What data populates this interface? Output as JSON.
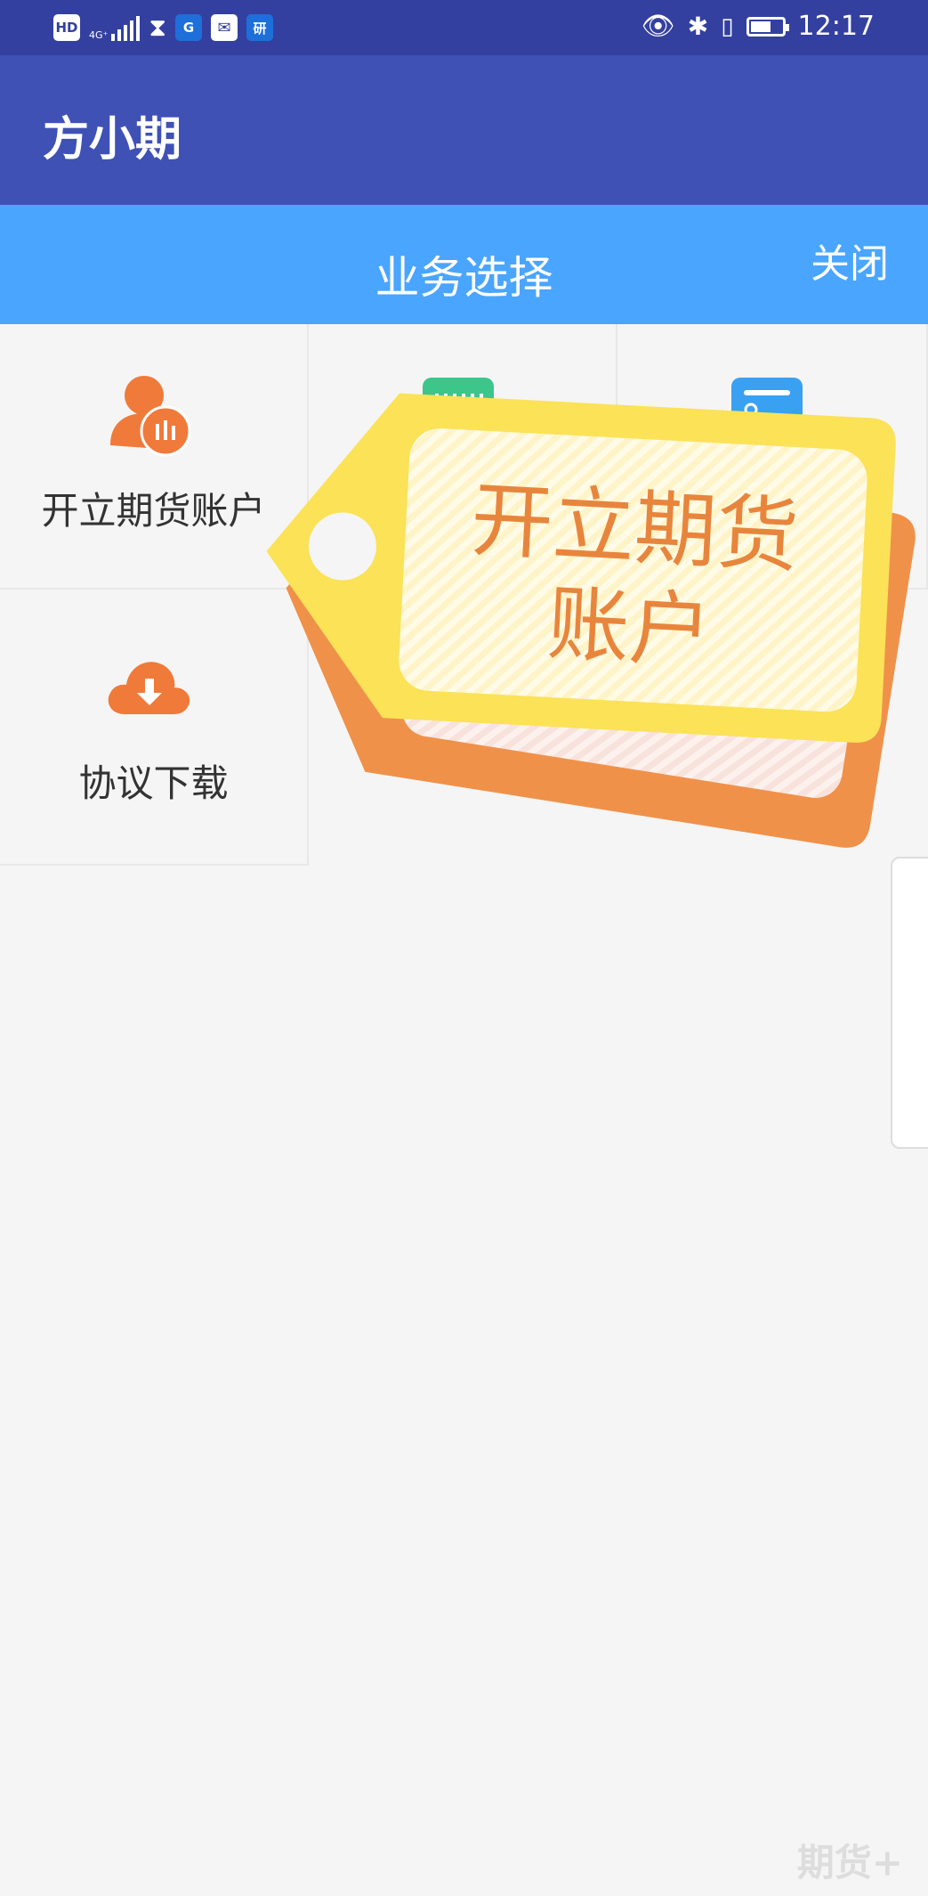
{
  "status_bar": {
    "hd": "HD",
    "network": "4G⁺",
    "app_icon_g": "G",
    "app_icon_yan": "研",
    "time": "12:17"
  },
  "app_bar": {
    "title": "方小期"
  },
  "sub_header": {
    "title": "业务选择",
    "close_label": "关闭"
  },
  "tiles": [
    {
      "label": "开立期货账户",
      "icon": "user-candlestick-icon"
    },
    {
      "label": "",
      "icon": "green-card-icon"
    },
    {
      "label": "",
      "icon": "blue-document-icon"
    },
    {
      "label": "协议下载",
      "icon": "cloud-download-icon"
    }
  ],
  "tag": {
    "line1": "开立期货",
    "line2": "账户"
  },
  "watermark": "期货+",
  "colors": {
    "status_bar": "#3340a0",
    "app_bar": "#3f51b5",
    "sub_header": "#4aa5ff",
    "accent_orange": "#f07a3a",
    "tag_yellow": "#fbe257",
    "tag_text": "#e8853d"
  }
}
